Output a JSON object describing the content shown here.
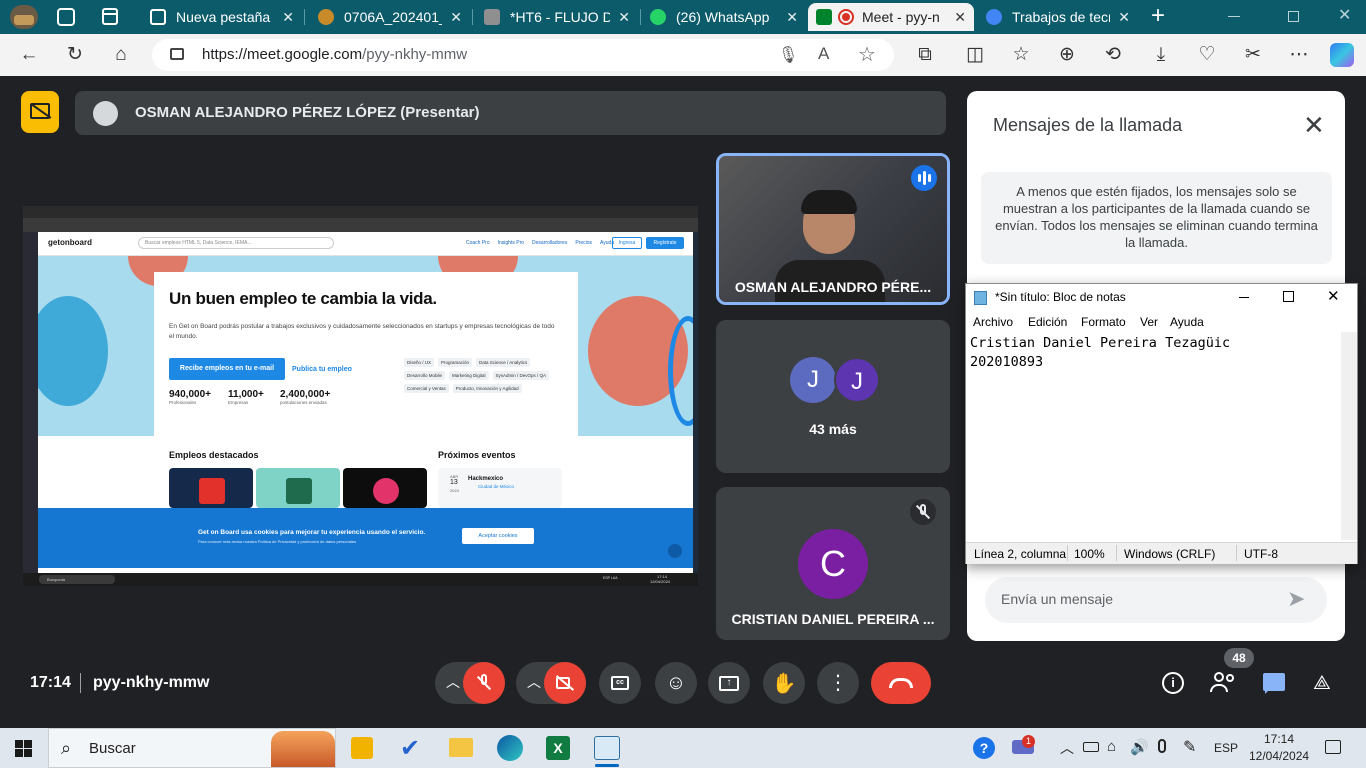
{
  "browser": {
    "tabs": [
      {
        "label": "",
        "icon": "profile-avatar-icon",
        "color": "#5b4a3a"
      },
      {
        "label": "",
        "icon": "collections-icon",
        "color": "#ffffff"
      },
      {
        "label": "",
        "icon": "tab-actions-icon",
        "color": "#ffffff"
      },
      {
        "label": "Nueva pestaña",
        "icon": "new-tab-page-icon",
        "color": "#5b8a95"
      },
      {
        "label": "0706A_202401_CU",
        "icon": "moodle-icon",
        "color": "#c98a2a"
      },
      {
        "label": "*HT6 - FLUJO DE",
        "icon": "pdf-icon",
        "color": "#8f8f8f"
      },
      {
        "label": "(26) WhatsApp",
        "icon": "whatsapp-icon",
        "color": "#25d366"
      },
      {
        "label": "Meet - pyy-n",
        "icon": "meet-icon",
        "color": "#00832d"
      },
      {
        "label": "Trabajos de tecnolo",
        "icon": "google-icon",
        "color": "#4285f4"
      }
    ],
    "url_host": "https://meet.google.com",
    "url_path": "/pyy-nkhy-mmw"
  },
  "meet": {
    "presenter_label": "OSMAN ALEJANDRO PÉREZ LÓPEZ (Presentar)",
    "tiles": {
      "osman_name": "OSMAN ALEJANDRO PÉRE...",
      "group_letters": [
        "J",
        "J"
      ],
      "group_more": "43 más",
      "cristian_initial": "C",
      "cristian_name": "CRISTIAN DANIEL PEREIRA ..."
    },
    "chat": {
      "title": "Mensajes de la llamada",
      "info": "A menos que estén fijados, los mensajes solo se muestran a los participantes de la llamada cuando se envían. Todos los mensajes se eliminan cuando termina la llamada.",
      "input_placeholder": "Envía un mensaje"
    },
    "footer": {
      "time": "17:14",
      "meeting_code": "pyy-nkhy-mmw",
      "participants_count": "48"
    }
  },
  "shared_screen": {
    "site_logo": "getonboard",
    "search_placeholder": "Buscar empleos HTML 5, Data Science, IEMA...",
    "nav": [
      "Coach Pro",
      "Insights Pro",
      "Desarrolladores",
      "Precios",
      "Ayuda"
    ],
    "login_label": "Ingresa",
    "register_label": "Regístrate",
    "headline": "Un buen empleo te cambia la vida.",
    "subtext": "En Get on Board podrás postular a trabajos exclusivos y cuidadosamente seleccionados en startups y empresas tecnológicas de todo el mundo.",
    "cta_primary": "Recibe empleos en tu e-mail",
    "cta_secondary": "Publica tu empleo",
    "stats": [
      {
        "value": "940,000+",
        "label": "Profesionales"
      },
      {
        "value": "11,000+",
        "label": "Empresas"
      },
      {
        "value": "2,400,000+",
        "label": "postulaciones enviadas"
      }
    ],
    "tags": [
      "Diseño / UX",
      "Programación",
      "Data Science / Analytics",
      "Desarrollo Mobile",
      "Marketing Digital",
      "SysAdmin / DevOps / QA",
      "Comercial y Ventas",
      "Producto, Innovación y Agilidad"
    ],
    "section_jobs": "Empleos destacados",
    "section_events": "Próximos eventos",
    "event_name": "Hackmexico",
    "event_place": "Ciudad de México",
    "event_month": "ABR",
    "event_day": "13",
    "event_year": "2024",
    "cookie_text": "Get on Board usa cookies para mejorar tu experiencia usando el servicio.",
    "cookie_sub": "Para conocer más revisa nuestra Política de Privacidad y protección de datos personales",
    "cookie_btn": "Aceptar cookies",
    "taskbar_search": "Búsqueda",
    "taskbar_time": "17:14",
    "taskbar_date": "12/04/2024",
    "taskbar_lang": "ESP LAA"
  },
  "notepad": {
    "title": "*Sin título: Bloc de notas",
    "menu": [
      "Archivo",
      "Edición",
      "Formato",
      "Ver",
      "Ayuda"
    ],
    "content": "Cristian Daniel Pereira Tezagüic\n202010893",
    "status_pos": "Línea 2, columna",
    "status_zoom": "100%",
    "status_eol": "Windows (CRLF)",
    "status_enc": "UTF-8"
  },
  "taskbar": {
    "search_placeholder": "Buscar",
    "lang": "ESP",
    "time": "17:14",
    "date": "12/04/2024",
    "badge": "1"
  }
}
